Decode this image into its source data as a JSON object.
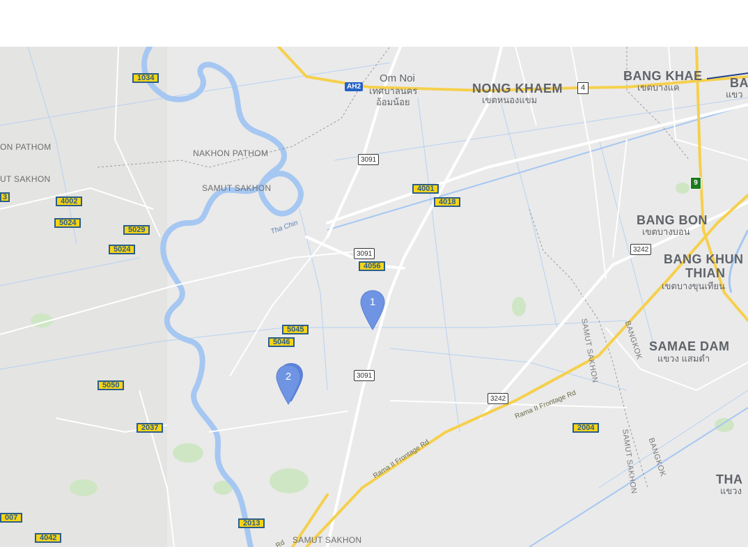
{
  "colors": {
    "land": "#eaeaea",
    "river": "#a5c7f2",
    "road_main": "#ffffff",
    "road_highway": "#f8d74d",
    "green": "#cde7c3",
    "marker": "#6f94e3"
  },
  "places": {
    "om_noi": "Om Noi",
    "om_noi_thai1": "เทศบาลนคร",
    "om_noi_thai2": "อ้อมน้อย",
    "nong_khaem": "NONG KHAEM",
    "nong_khaem_thai": "เขตหนองแขม",
    "bang_khae": "BANG KHAE",
    "bang_khae_thai": "เขตบางแค",
    "ba_cut": "BA",
    "ba_cut_thai": "แขว",
    "bang_bon": "BANG BON",
    "bang_bon_thai": "เขตบางบอน",
    "bang_khun": "BANG KHUN",
    "thian": "THIAN",
    "bang_khun_thai": "เขตบางขุนเทียน",
    "samae_dam": "SAMAE DAM",
    "samae_dam_thai": "แขวง แสมดำ",
    "tha_cut": "THA",
    "tha_cut_thai": "แขวง",
    "nakhon_pathom": "NAKHON PATHOM",
    "samut_sakhon": "SAMUT SAKHON",
    "on_pathom_cut": "ON PATHOM",
    "ut_sakhon_cut": "UT SAKHON",
    "samut_sakhon_bottom": "SAMUT SAKHON",
    "samut_sakhon_vert1": "SAMUT SAKHON",
    "samut_sakhon_vert2": "SAMUT SAKHON",
    "bangkok_vert1": "BANGKOK",
    "bangkok_vert2": "BANGKOK"
  },
  "rivers": {
    "tha_chin": "Tha Chin"
  },
  "roads": {
    "rama2_a": "Rama II Frontage Rd",
    "rama2_b": "Rama II Frontage Rd",
    "rd_cut": "Rd"
  },
  "shields": {
    "s1034": "1034",
    "s4002": "4002",
    "s5024a": "5024",
    "s5029": "5029",
    "s5024b": "5024",
    "s5050": "5050",
    "s2037": "2037",
    "s2013": "2013",
    "s4042": "4042",
    "s007": "007",
    "s4001": "4001",
    "s4018": "4018",
    "s4056": "4056",
    "s5045": "5045",
    "s5046": "5046",
    "s2004": "2004",
    "s3091a": "3091",
    "s3091b": "3091",
    "s3091c": "3091",
    "s3242a": "3242",
    "s3242b": "3242",
    "ah2": "AH2",
    "s4": "4",
    "s9": "9",
    "cut3": "3"
  },
  "markers": {
    "m1": "1",
    "m2": "2"
  }
}
